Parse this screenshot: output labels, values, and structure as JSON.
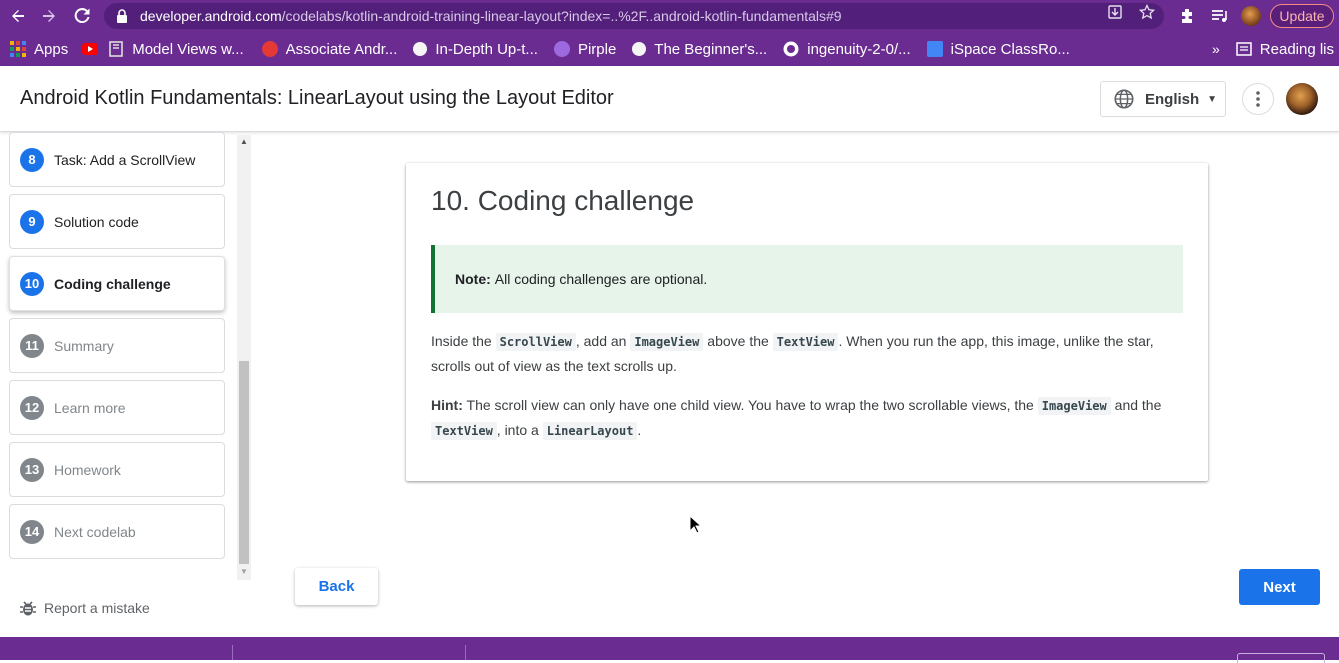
{
  "browser": {
    "url_host": "developer.android.com",
    "url_path": "/codelabs/kotlin-android-training-linear-layout?index=..%2F..android-kotlin-fundamentals#9",
    "update_label": "Update",
    "bookmarks": [
      {
        "label": "Apps",
        "color": "#ffffff"
      },
      {
        "label": "",
        "color": "#ff0000"
      },
      {
        "label": "Model Views w...",
        "color": "#e8e8e8"
      },
      {
        "label": "Associate Andr...",
        "color": "#e53935"
      },
      {
        "label": "In-Depth Up-t...",
        "color": "#ffffff"
      },
      {
        "label": "Pirple",
        "color": "#9c6ade"
      },
      {
        "label": "The Beginner's...",
        "color": "#ffffff"
      },
      {
        "label": "ingenuity-2-0/...",
        "color": "#ffffff"
      },
      {
        "label": "iSpace ClassRo...",
        "color": "#4285f4"
      }
    ],
    "reading_list_label": "Reading lis"
  },
  "header": {
    "title": "Android Kotlin Fundamentals: LinearLayout using the Layout Editor",
    "language": "English"
  },
  "sidebar": {
    "steps": [
      {
        "num": "8",
        "label": "Task: Add a ScrollView",
        "state": "done"
      },
      {
        "num": "9",
        "label": "Solution code",
        "state": "done"
      },
      {
        "num": "10",
        "label": "Coding challenge",
        "state": "active"
      },
      {
        "num": "11",
        "label": "Summary",
        "state": "todo"
      },
      {
        "num": "12",
        "label": "Learn more",
        "state": "todo"
      },
      {
        "num": "13",
        "label": "Homework",
        "state": "todo"
      },
      {
        "num": "14",
        "label": "Next codelab",
        "state": "todo"
      }
    ],
    "report_label": "Report a mistake"
  },
  "content": {
    "heading": "10. Coding challenge",
    "note_label": "Note:",
    "note_text": "All coding challenges are optional.",
    "para1": {
      "t1": "Inside the ",
      "c1": "ScrollView",
      "t2": ", add an ",
      "c2": "ImageView",
      "t3": " above the ",
      "c3": "TextView",
      "t4": ". When you run the app, this image, unlike the star, scrolls out of view as the text scrolls up."
    },
    "para2": {
      "hint_label": "Hint:",
      "t1": " The scroll view can only have one child view. You have to wrap the two scrollable views, the ",
      "c1": "ImageView",
      "t2": " and the ",
      "c2": "TextView",
      "t3": ", into a ",
      "c3": "LinearLayout",
      "t4": "."
    }
  },
  "nav": {
    "back_label": "Back",
    "next_label": "Next"
  },
  "colors": {
    "chrome": "#6a2c91",
    "primary": "#1a73e8",
    "note_bg": "#e6f4ea",
    "note_border": "#137333"
  }
}
